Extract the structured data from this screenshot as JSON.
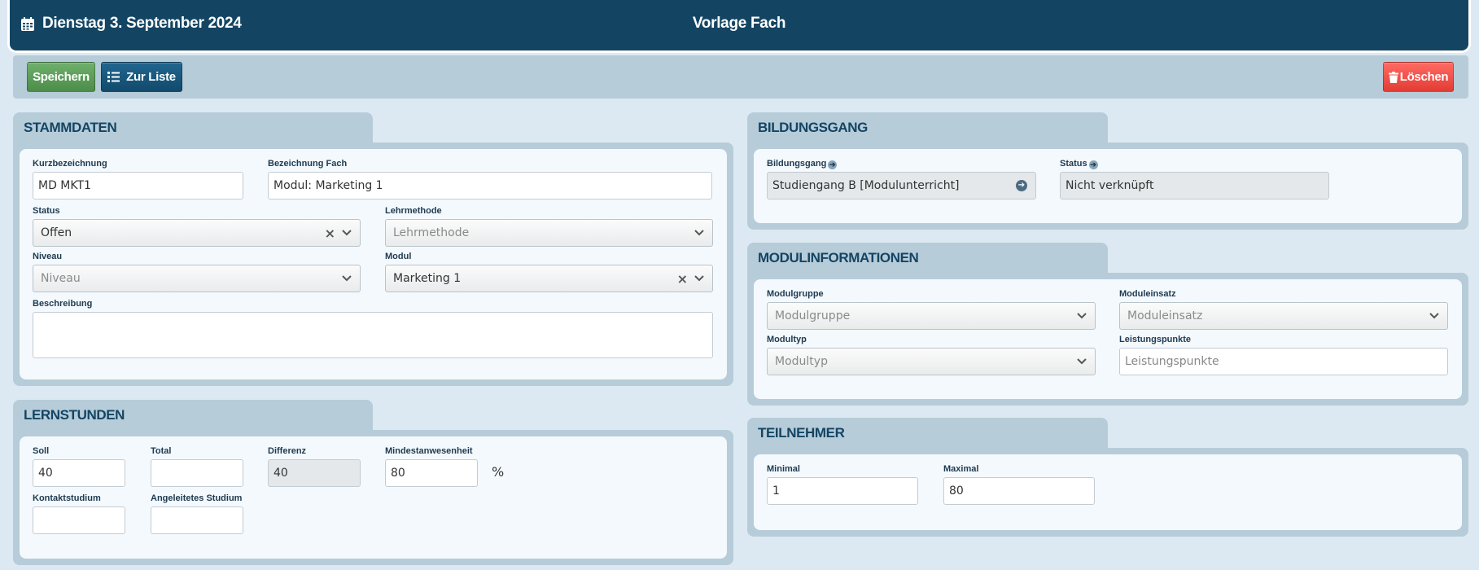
{
  "header": {
    "date": "Dienstag 3. September 2024",
    "title": "Vorlage Fach"
  },
  "toolbar": {
    "save_label": "Speichern",
    "list_label": "Zur Liste",
    "delete_label": "Löschen"
  },
  "stammdaten": {
    "title": "STAMMDATEN",
    "kurz_label": "Kurzbezeichnung",
    "kurz_value": "MD MKT1",
    "bez_label": "Bezeichnung Fach",
    "bez_value": "Modul: Marketing 1",
    "status_label": "Status",
    "status_value": "Offen",
    "lehr_label": "Lehrmethode",
    "lehr_placeholder": "Lehrmethode",
    "niveau_label": "Niveau",
    "niveau_placeholder": "Niveau",
    "modul_label": "Modul",
    "modul_value": "Marketing 1",
    "beschr_label": "Beschreibung"
  },
  "lernstunden": {
    "title": "LERNSTUNDEN",
    "soll_label": "Soll",
    "soll_value": "40",
    "total_label": "Total",
    "total_value": "",
    "diff_label": "Differenz",
    "diff_value": "40",
    "mind_label": "Mindestanwesenheit",
    "mind_value": "80",
    "mind_unit": "%",
    "kontakt_label": "Kontaktstudium",
    "angel_label": "Angeleitetes Studium"
  },
  "bildungsgang": {
    "title": "BILDUNGSGANG",
    "bg_label": "Bildungsgang",
    "bg_value": "Studiengang B [Modulunterricht]",
    "status_label": "Status",
    "status_value": "Nicht verknüpft"
  },
  "modulinfo": {
    "title": "MODULINFORMATIONEN",
    "gruppe_label": "Modulgruppe",
    "gruppe_placeholder": "Modulgruppe",
    "einsatz_label": "Moduleinsatz",
    "einsatz_placeholder": "Moduleinsatz",
    "typ_label": "Modultyp",
    "typ_placeholder": "Modultyp",
    "punkte_label": "Leistungspunkte",
    "punkte_placeholder": "Leistungspunkte"
  },
  "teilnehmer": {
    "title": "TEILNEHMER",
    "min_label": "Minimal",
    "min_value": "1",
    "max_label": "Maximal",
    "max_value": "80"
  },
  "colors": {
    "header": "#134563",
    "panel": "#b7ccd9",
    "save": "#5a9e57",
    "delete": "#f04d45"
  }
}
